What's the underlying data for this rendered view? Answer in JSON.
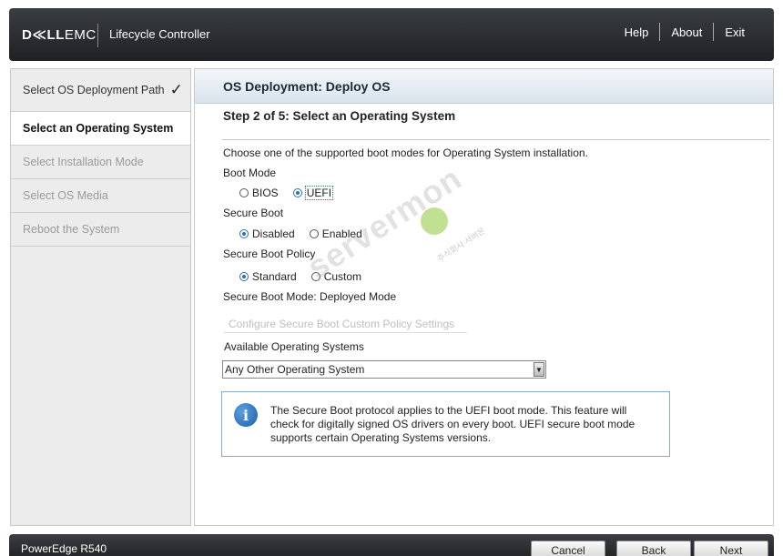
{
  "header": {
    "brand_dell": "D≪LL",
    "brand_emc": "EMC",
    "app_title": "Lifecycle Controller",
    "links": {
      "help": "Help",
      "about": "About",
      "exit": "Exit"
    }
  },
  "sidebar": {
    "items": [
      {
        "label": "Select OS Deployment Path",
        "state": "done"
      },
      {
        "label": "Select an Operating System",
        "state": "active"
      },
      {
        "label": "Select Installation Mode",
        "state": "disabled"
      },
      {
        "label": "Select OS Media",
        "state": "disabled"
      },
      {
        "label": "Reboot the System",
        "state": "disabled"
      }
    ],
    "check_icon": "✓"
  },
  "main": {
    "title": "OS Deployment: Deploy OS",
    "step_title": "Step 2 of 5: Select an Operating System",
    "intro": "Choose one of the supported boot modes for Operating System installation.",
    "boot_mode": {
      "label": "Boot Mode",
      "options": [
        "BIOS",
        "UEFI"
      ],
      "selected": "UEFI"
    },
    "secure_boot": {
      "label": "Secure Boot",
      "options": [
        "Disabled",
        "Enabled"
      ],
      "selected": "Disabled"
    },
    "secure_boot_policy": {
      "label": "Secure Boot Policy",
      "options": [
        "Standard",
        "Custom"
      ],
      "selected": "Standard"
    },
    "secure_boot_mode": "Secure Boot Mode: Deployed Mode",
    "configure_button": "Configure Secure Boot Custom Policy Settings",
    "available_os": {
      "label": "Available Operating Systems",
      "selected": "Any Other Operating System"
    },
    "info": {
      "icon": "info-icon",
      "text": "The Secure Boot protocol applies to the UEFI boot mode. This feature will check for digitally signed OS drivers on every boot. UEFI secure boot mode supports certain Operating Systems versions."
    }
  },
  "watermark": {
    "text": "servermon",
    "sub": "주식회사 서버몬"
  },
  "footer": {
    "model": "PowerEdge R540",
    "buttons": {
      "cancel": "Cancel",
      "back": "Back",
      "next": "Next"
    }
  }
}
